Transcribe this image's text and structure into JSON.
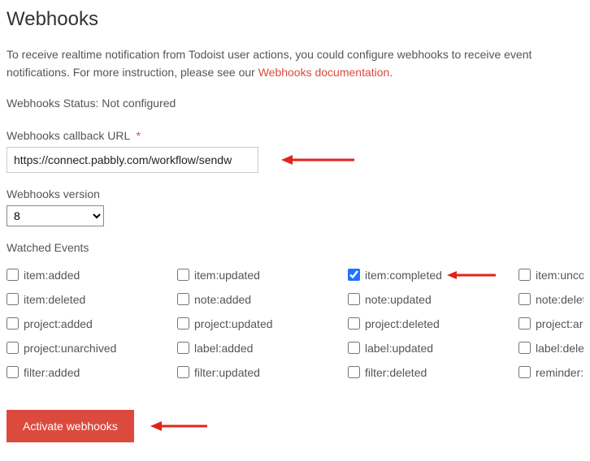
{
  "page": {
    "title": "Webhooks",
    "intro_a": "To receive realtime notification from Todoist user actions, you could configure webhooks to receive event notifications. For more instruction, please see our ",
    "doc_link_text": "Webhooks documentation",
    "intro_b": ".",
    "status_line": "Webhooks Status: Not configured"
  },
  "callback": {
    "label": "Webhooks callback URL",
    "value": "https://connect.pabbly.com/workflow/sendw"
  },
  "version": {
    "label": "Webhooks version",
    "selected": "8",
    "options": [
      "8"
    ]
  },
  "events": {
    "label": "Watched Events",
    "items": [
      {
        "name": "item:added",
        "checked": false
      },
      {
        "name": "item:updated",
        "checked": false
      },
      {
        "name": "item:completed",
        "checked": true
      },
      {
        "name": "item:uncompleted",
        "checked": false
      },
      {
        "name": "item:deleted",
        "checked": false
      },
      {
        "name": "note:added",
        "checked": false
      },
      {
        "name": "note:updated",
        "checked": false
      },
      {
        "name": "note:deleted",
        "checked": false
      },
      {
        "name": "project:added",
        "checked": false
      },
      {
        "name": "project:updated",
        "checked": false
      },
      {
        "name": "project:deleted",
        "checked": false
      },
      {
        "name": "project:archived",
        "checked": false
      },
      {
        "name": "project:unarchived",
        "checked": false
      },
      {
        "name": "label:added",
        "checked": false
      },
      {
        "name": "label:updated",
        "checked": false
      },
      {
        "name": "label:deleted",
        "checked": false
      },
      {
        "name": "filter:added",
        "checked": false
      },
      {
        "name": "filter:updated",
        "checked": false
      },
      {
        "name": "filter:deleted",
        "checked": false
      },
      {
        "name": "reminder:fired",
        "checked": false
      }
    ]
  },
  "button": {
    "activate": "Activate webhooks"
  }
}
